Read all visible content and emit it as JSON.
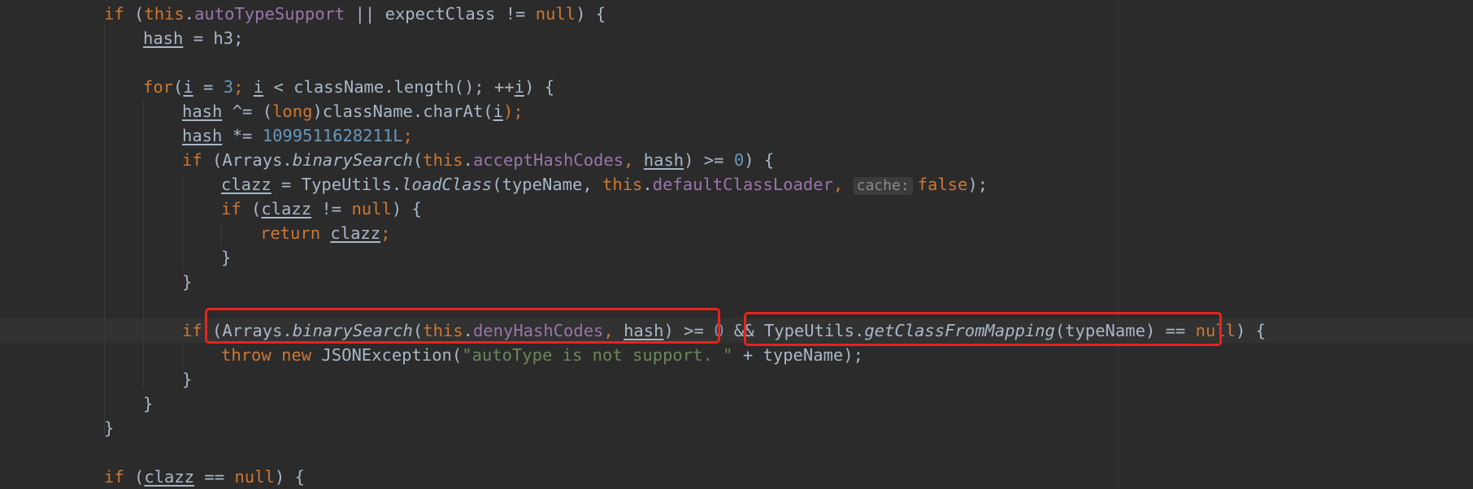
{
  "code": {
    "l1": {
      "if": "if",
      "p1": " (",
      "this": "this",
      "dot": ".",
      "field": "autoTypeSupport",
      "mid": " || expectClass != ",
      "null": "null",
      "end": ") {"
    },
    "l2": {
      "var": "hash",
      "rest": " = h3;"
    },
    "l4": {
      "for": "for",
      "p1": "(",
      "i1": "i",
      "eq": " = ",
      "n3": "3",
      "semi1": "; ",
      "i2": "i",
      "cmp": " < className.length(); ++",
      "i3": "i",
      "end": ") {"
    },
    "l5": {
      "var": "hash",
      "op": " ^= (",
      "long": "long",
      "call": ")className.charAt(",
      "i": "i",
      "end": ");"
    },
    "l6": {
      "var": "hash",
      "op": " *= ",
      "num": "1099511628211L",
      "end": ";"
    },
    "l7": {
      "if": "if",
      "p1": " (Arrays.",
      "method": "binarySearch",
      "p2": "(",
      "this": "this",
      "dot": ".",
      "field": "acceptHashCodes",
      "comma": ", ",
      "hash": "hash",
      "cmp": ") >= ",
      "zero": "0",
      "end": ") {"
    },
    "l8": {
      "var": "clazz",
      "p1": " = TypeUtils.",
      "method": "loadClass",
      "p2": "(typeName, ",
      "this": "this",
      "dot": ".",
      "field": "defaultClassLoader",
      "comma": ", ",
      "hint": "cache:",
      "false": "false",
      "end": ");"
    },
    "l9": {
      "if": "if",
      "p1": " (",
      "var": "clazz",
      "p2": " != ",
      "null": "null",
      "end": ") {"
    },
    "l10": {
      "return": "return",
      "sp": " ",
      "var": "clazz",
      "end": ";"
    },
    "l11": {
      "brace": "}"
    },
    "l12": {
      "brace": "}"
    },
    "l14": {
      "if": "if",
      "p1": " (Arrays.",
      "method": "binarySearch",
      "p2": "(",
      "this": "this",
      "dot": ".",
      "field": "denyHashCodes",
      "comma": ", ",
      "hash": "hash",
      "cmp": ") >= ",
      "zero": "0",
      "and": " && ",
      "tu": "TypeUtils.",
      "method2": "getClassFromMapping",
      "p3": "(typeName) == ",
      "null": "null",
      "end": ") {"
    },
    "l15": {
      "throw": "throw",
      "sp": " ",
      "new": "new",
      "p1": " JSONException(",
      "str": "\"autoType is not support. \"",
      "end": " + typeName);"
    },
    "l16": {
      "brace": "}"
    },
    "l17": {
      "brace": "}"
    },
    "l18": {
      "brace": "}"
    },
    "l20": {
      "if": "if",
      "p1": " (",
      "var": "clazz",
      "p2": " == ",
      "null": "null",
      "end": ") {"
    }
  },
  "colors": {
    "background": "#2b2b2b",
    "keyword": "#cc7832",
    "field": "#9876aa",
    "number": "#6897bb",
    "string": "#6a8759",
    "text": "#a9b7c6",
    "highlight": "#e8231d"
  }
}
